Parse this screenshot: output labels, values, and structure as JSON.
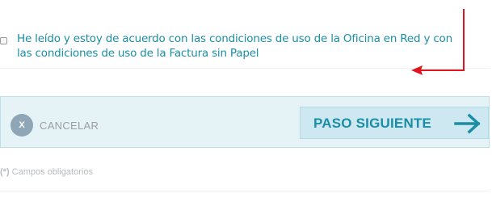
{
  "terms": {
    "text": "He leído y estoy de acuerdo con las condiciones de uso de la Oficina en Red y con las condiciones de uso de la Factura sin Papel",
    "checked": false
  },
  "actions": {
    "cancel_icon_glyph": "X",
    "cancel_label": "CANCELAR",
    "next_label": "PASO SIGUIENTE"
  },
  "footer": {
    "required_marker": "(*)",
    "required_text": "Campos obligatorios"
  },
  "colors": {
    "accent_teal": "#1b8ea5",
    "annotation_red": "#e0141e",
    "bar_background": "#e5f3f7",
    "next_button_background": "#cde8f0",
    "cancel_icon_background": "#8fa6b7"
  },
  "icons": {
    "annotation": "red-pointer-arrow-icon",
    "next": "arrow-right-icon",
    "cancel": "cancel-x-icon"
  }
}
